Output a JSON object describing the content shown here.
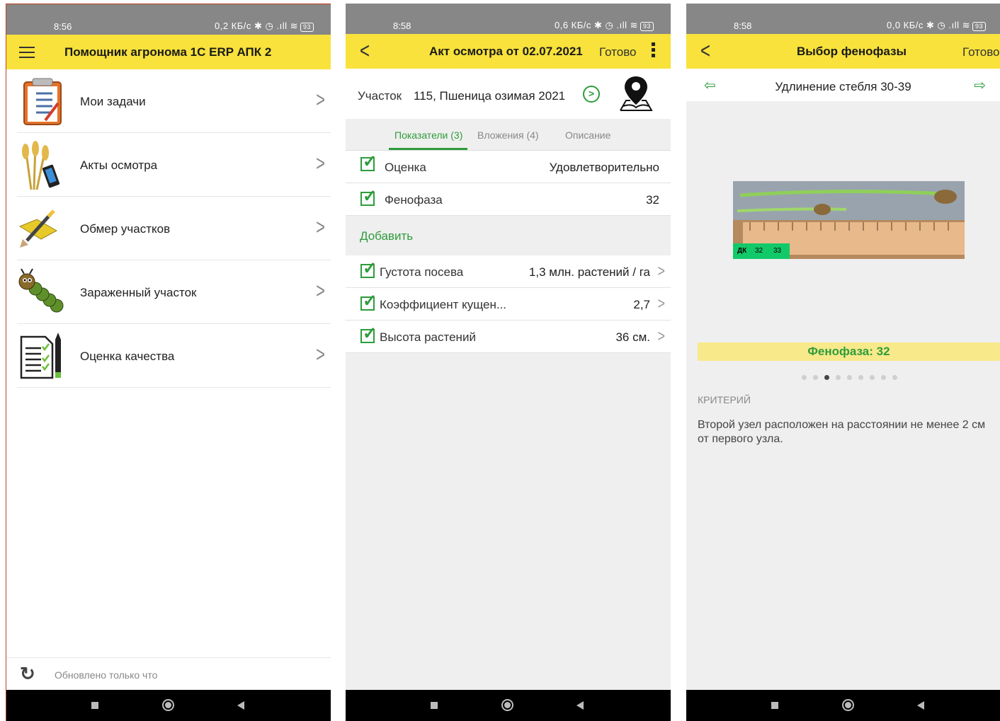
{
  "screen1": {
    "status": {
      "time": "8:56",
      "net": "0,2 КБ/с",
      "battery": "93"
    },
    "title": "Помощник агронома 1С ERP АПК 2",
    "menu": [
      {
        "label": "Мои задачи",
        "icon": "clipboard-checklist-icon"
      },
      {
        "label": "Акты осмотра",
        "icon": "wheat-phone-icon"
      },
      {
        "label": "Обмер участков",
        "icon": "measure-pencil-icon"
      },
      {
        "label": "Зараженный участок",
        "icon": "caterpillar-icon"
      },
      {
        "label": "Оценка качества",
        "icon": "checklist-pen-icon"
      }
    ],
    "footer": "Обновлено только что"
  },
  "screen2": {
    "status": {
      "time": "8:58",
      "net": "0,6 КБ/с",
      "battery": "93"
    },
    "title": "Акт осмотра от 02.07.2021",
    "ready": "Готово",
    "plot_label": "Участок",
    "plot_value": "115, Пшеница озимая 2021",
    "tabs": [
      "Показатели (3)",
      "Вложения (4)",
      "Описание"
    ],
    "main_rows": [
      {
        "label": "Оценка",
        "value": "Удовлетворительно"
      },
      {
        "label": "Фенофаза",
        "value": "32"
      }
    ],
    "add": "Добавить",
    "extra_rows": [
      {
        "label": "Густота посева",
        "value": "1,3 млн. растений / га"
      },
      {
        "label": "Коэффициент кущен...",
        "value": "2,7"
      },
      {
        "label": "Высота растений",
        "value": "36 см."
      }
    ]
  },
  "screen3": {
    "status": {
      "time": "8:58",
      "net": "0,0 КБ/с",
      "battery": "93"
    },
    "title": "Выбор фенофазы",
    "ready": "Готово",
    "phase_title": "Удлинение стебля 30-39",
    "photo_tag": {
      "prefix": "ДК",
      "a": "32",
      "b": "33"
    },
    "phase": "Фенофаза: 32",
    "dots_active": 3,
    "criterion_header": "КРИТЕРИЙ",
    "criterion_text": "Второй узел расположен на расстоянии не менее 2 см от первого узла."
  },
  "colors": {
    "appbar": "#f8e23b",
    "accent": "#2e9c3c",
    "statusbar": "#878787"
  }
}
